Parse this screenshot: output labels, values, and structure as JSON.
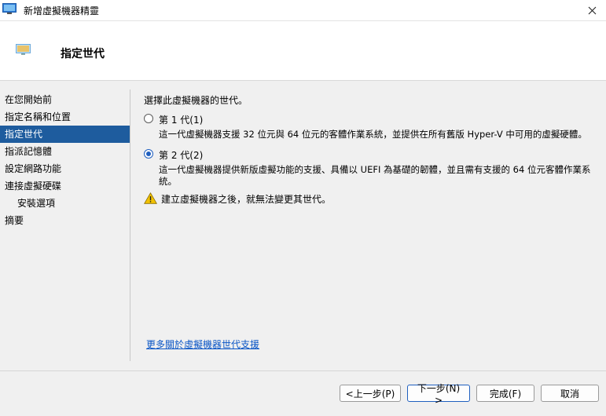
{
  "window": {
    "title": "新增虛擬機器精靈",
    "close_symbol": "✕"
  },
  "header": {
    "title": "指定世代"
  },
  "nav": {
    "items": [
      {
        "label": "在您開始前"
      },
      {
        "label": "指定名稱和位置"
      },
      {
        "label": "指定世代"
      },
      {
        "label": "指派記憶體"
      },
      {
        "label": "設定網路功能"
      },
      {
        "label": "連接虛擬硬碟"
      },
      {
        "label": "安裝選項"
      },
      {
        "label": "摘要"
      }
    ],
    "active_index": 2
  },
  "content": {
    "prompt": "選擇此虛擬機器的世代。",
    "options": [
      {
        "label": "第 1 代(1)",
        "description": "這一代虛擬機器支援 32 位元與 64 位元的客體作業系統，並提供在所有舊版 Hyper-V 中可用的虛擬硬體。",
        "selected": false
      },
      {
        "label": "第 2 代(2)",
        "description": "這一代虛擬機器提供新版虛擬功能的支援、具備以 UEFI 為基礎的韌體，並且需有支援的 64 位元客體作業系統。",
        "selected": true
      }
    ],
    "warning": "建立虛擬機器之後，就無法變更其世代。",
    "more_link": "更多關於虛擬機器世代支援"
  },
  "buttons": {
    "previous": "<上一步(P)",
    "next": "下一步(N) >",
    "finish": "完成(F)",
    "cancel": "取消"
  },
  "colors": {
    "accent": "#1e5c9e",
    "link": "#0b56c6",
    "warning": "#f2c200"
  },
  "icons": {
    "app": "hyper-v-monitor-icon",
    "header": "hyper-v-monitor-icon",
    "warning": "warning-triangle-icon",
    "close": "close-icon"
  }
}
